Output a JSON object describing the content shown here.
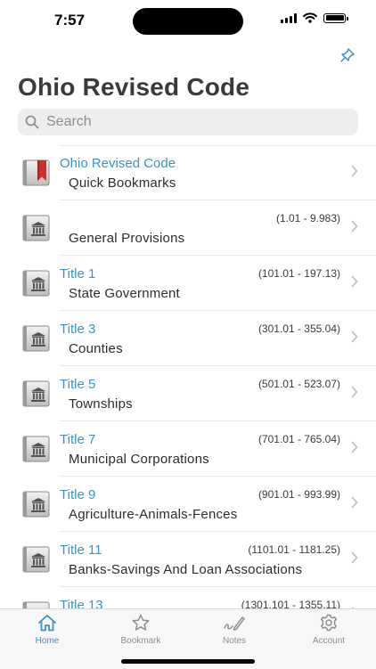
{
  "status": {
    "time": "7:57"
  },
  "header": {
    "title": "Ohio Revised Code"
  },
  "search": {
    "placeholder": "Search",
    "value": ""
  },
  "rows": [
    {
      "icon": "bookmark-book-icon",
      "title": "Ohio Revised Code",
      "range": "",
      "subtitle": "Quick Bookmarks"
    },
    {
      "icon": "building-book-icon",
      "title": "",
      "range": "(1.01 - 9.983)",
      "subtitle": "General Provisions"
    },
    {
      "icon": "building-book-icon",
      "title": "Title  1",
      "range": "(101.01 - 197.13)",
      "subtitle": "State Government"
    },
    {
      "icon": "building-book-icon",
      "title": "Title  3",
      "range": "(301.01 - 355.04)",
      "subtitle": "Counties"
    },
    {
      "icon": "building-book-icon",
      "title": "Title  5",
      "range": "(501.01 - 523.07)",
      "subtitle": "Townships"
    },
    {
      "icon": "building-book-icon",
      "title": "Title  7",
      "range": "(701.01 - 765.04)",
      "subtitle": "Municipal Corporations"
    },
    {
      "icon": "building-book-icon",
      "title": "Title  9",
      "range": "(901.01 - 993.99)",
      "subtitle": "Agriculture-Animals-Fences"
    },
    {
      "icon": "building-book-icon",
      "title": "Title  11",
      "range": "(1101.01 - 1181.25)",
      "subtitle": "Banks-Savings And Loan Associations"
    },
    {
      "icon": "building-book-icon",
      "title": "Title  13",
      "range": "(1301.101 - 1355.11)",
      "subtitle": ""
    }
  ],
  "tabs": [
    {
      "label": "Home",
      "icon": "home-icon",
      "active": true
    },
    {
      "label": "Bookmark",
      "icon": "star-icon",
      "active": false
    },
    {
      "label": "Notes",
      "icon": "pencil-icon",
      "active": false
    },
    {
      "label": "Account",
      "icon": "gear-icon",
      "active": false
    }
  ],
  "colors": {
    "accent": "#3a93c7",
    "title": "#3a3a3c",
    "bookmark_red": "#c9302c"
  }
}
